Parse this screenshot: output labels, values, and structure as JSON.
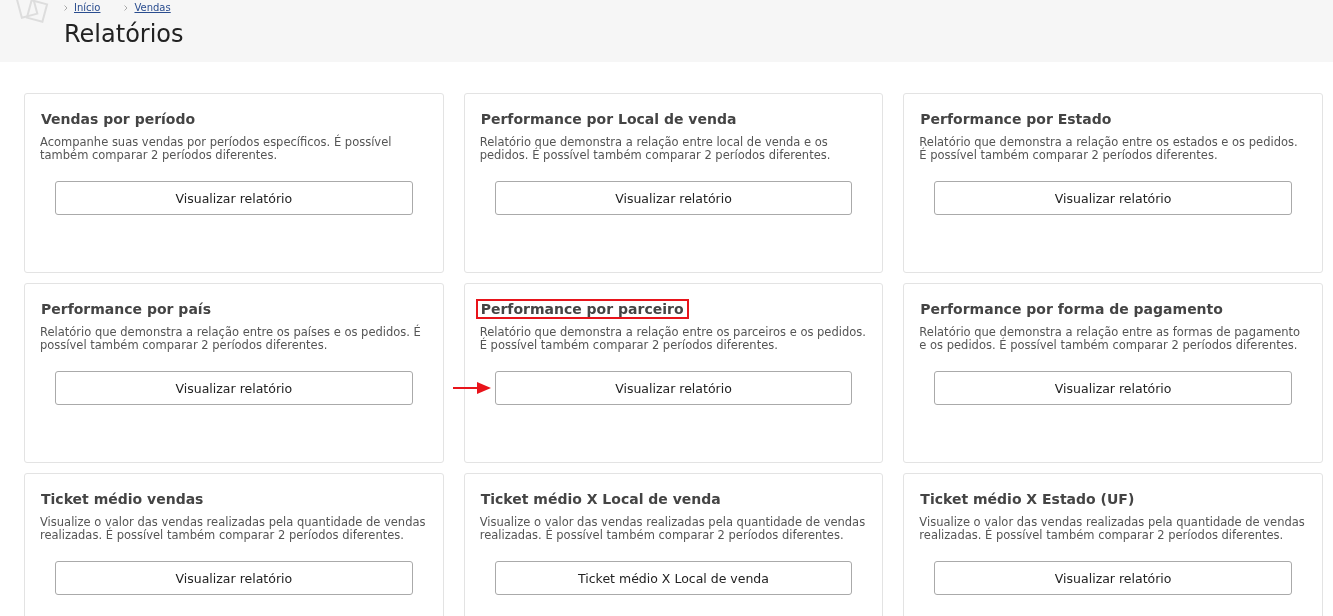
{
  "breadcrumb": [
    {
      "label": "Início"
    },
    {
      "label": "Vendas"
    }
  ],
  "page_title": "Relatórios",
  "reports": [
    {
      "title": "Vendas por período",
      "description": "Acompanhe suas vendas por períodos específicos. É possível também comparar 2 períodos diferentes.",
      "button": "Visualizar relatório",
      "highlighted": false
    },
    {
      "title": "Performance por Local de venda",
      "description": "Relatório que demonstra a relação entre local de venda e os pedidos. É possível também comparar 2 períodos diferentes.",
      "button": "Visualizar relatório",
      "highlighted": false
    },
    {
      "title": "Performance por Estado",
      "description": "Relatório que demonstra a relação entre os estados e os pedidos. É possível também comparar 2 períodos diferentes.",
      "button": "Visualizar relatório",
      "highlighted": false
    },
    {
      "title": "Performance por país",
      "description": "Relatório que demonstra a relação entre os países e os pedidos. É possível também comparar 2 períodos diferentes.",
      "button": "Visualizar relatório",
      "highlighted": false
    },
    {
      "title": "Performance por parceiro",
      "description": "Relatório que demonstra a relação entre os parceiros e os pedidos. É possível também comparar 2 períodos diferentes.",
      "button": "Visualizar relatório",
      "highlighted": true
    },
    {
      "title": "Performance por forma de pagamento",
      "description": "Relatório que demonstra a relação entre as formas de pagamento e os pedidos. É possível também comparar 2 períodos diferentes.",
      "button": "Visualizar relatório",
      "highlighted": false
    },
    {
      "title": "Ticket médio vendas",
      "description": "Visualize o valor das vendas realizadas pela quantidade de vendas realizadas. É possível também comparar 2 períodos diferentes.",
      "button": "Visualizar relatório",
      "highlighted": false
    },
    {
      "title": "Ticket médio X Local de venda",
      "description": "Visualize o valor das vendas realizadas pela quantidade de vendas realizadas. É possível também comparar 2 períodos diferentes.",
      "button": "Ticket médio X Local de venda",
      "highlighted": false
    },
    {
      "title": "Ticket médio X Estado (UF)",
      "description": "Visualize o valor das vendas realizadas pela quantidade de vendas realizadas. É possível também comparar 2 períodos diferentes.",
      "button": "Visualizar relatório",
      "highlighted": false
    }
  ]
}
